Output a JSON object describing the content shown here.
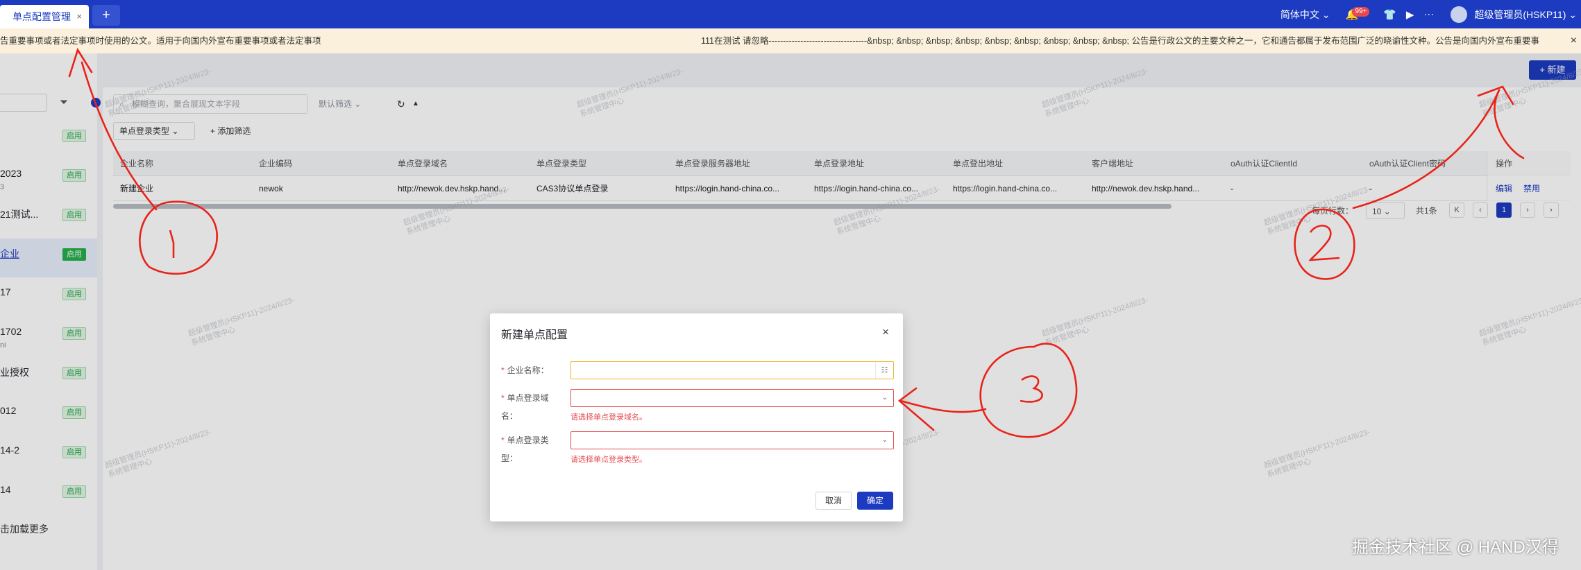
{
  "topbar": {
    "tab_label": "单点配置管理",
    "tab_close": "×",
    "add_tab": "+",
    "language": "简体中文",
    "notification_count": "99+",
    "more": "···",
    "username": "超级管理员(HSKP11)"
  },
  "notice": {
    "text_left": "告重要事项或者法定事项时使用的公文。适用于向国内外宣布重要事项或者法定事项",
    "text_right": "111在测试 请忽略----------------------------------&nbsp; &nbsp; &nbsp; &nbsp; &nbsp; &nbsp; &nbsp; &nbsp; &nbsp; 公告是行政公文的主要文种之一，它和通告都属于发布范围广泛的晓谕性文种。公告是向国内外宣布重要事",
    "close": "×"
  },
  "sidebar": {
    "items": [
      {
        "name": "",
        "sub": "",
        "status": "启用"
      },
      {
        "name": "2023",
        "sub": "3",
        "status": "启用"
      },
      {
        "name": "21测试...",
        "sub": "",
        "status": "启用"
      },
      {
        "name": "企业",
        "sub": "",
        "status": "启用"
      },
      {
        "name": "17",
        "sub": "",
        "status": "启用"
      },
      {
        "name": "1702",
        "sub": "ni",
        "status": "启用"
      },
      {
        "name": "业授权",
        "sub": "",
        "status": "启用"
      },
      {
        "name": "012",
        "sub": "",
        "status": "启用"
      },
      {
        "name": "14-2",
        "sub": "",
        "status": "启用"
      },
      {
        "name": "14",
        "sub": "",
        "status": "启用"
      }
    ],
    "load_more": "击加载更多"
  },
  "toolbar": {
    "new_button": "+ 新建",
    "search_placeholder": "模糊查询，聚合展现文本字段",
    "default_filter": "默认筛选",
    "type_filter": "单点登录类型",
    "add_filter": "+ 添加筛选"
  },
  "table": {
    "headers": [
      "企业名称",
      "企业编码",
      "单点登录域名",
      "单点登录类型",
      "单点登录服务器地址",
      "单点登录地址",
      "单点登出地址",
      "客户端地址",
      "oAuth认证ClientId",
      "oAuth认证Client密码",
      "操作"
    ],
    "rows": [
      [
        "新建企业",
        "newok",
        "http://newok.dev.hskp.hand...",
        "CAS3协议单点登录",
        "https://login.hand-china.co...",
        "https://login.hand-china.co...",
        "https://login.hand-china.co...",
        "http://newok.dev.hskp.hand...",
        "-",
        "-"
      ]
    ],
    "actions": [
      "编辑",
      "禁用"
    ]
  },
  "pagination": {
    "page_size_label": "每页行数：",
    "page_size": "10",
    "total": "共1条",
    "current": "1"
  },
  "modal": {
    "title": "新建单点配置",
    "close": "×",
    "fields": [
      {
        "label": "企业名称：",
        "value": "",
        "error": ""
      },
      {
        "label": "单点登录域名：",
        "value": "",
        "error": "请选择单点登录域名。"
      },
      {
        "label": "单点登录类型：",
        "value": "",
        "error": "请选择单点登录类型。"
      }
    ],
    "cancel": "取消",
    "ok": "确定"
  },
  "watermark": {
    "line1": "超级管理员(HSKP11)-2024/8/23-",
    "line2": "系统管理中心"
  },
  "annotations": [
    "1",
    "2",
    "3"
  ],
  "credit": "掘金技术社区 @ HAND汉得",
  "colors": {
    "brand": "#1c3bc0",
    "error": "#e5484d",
    "enabled": "#18a342",
    "annotation": "#e8231a"
  }
}
